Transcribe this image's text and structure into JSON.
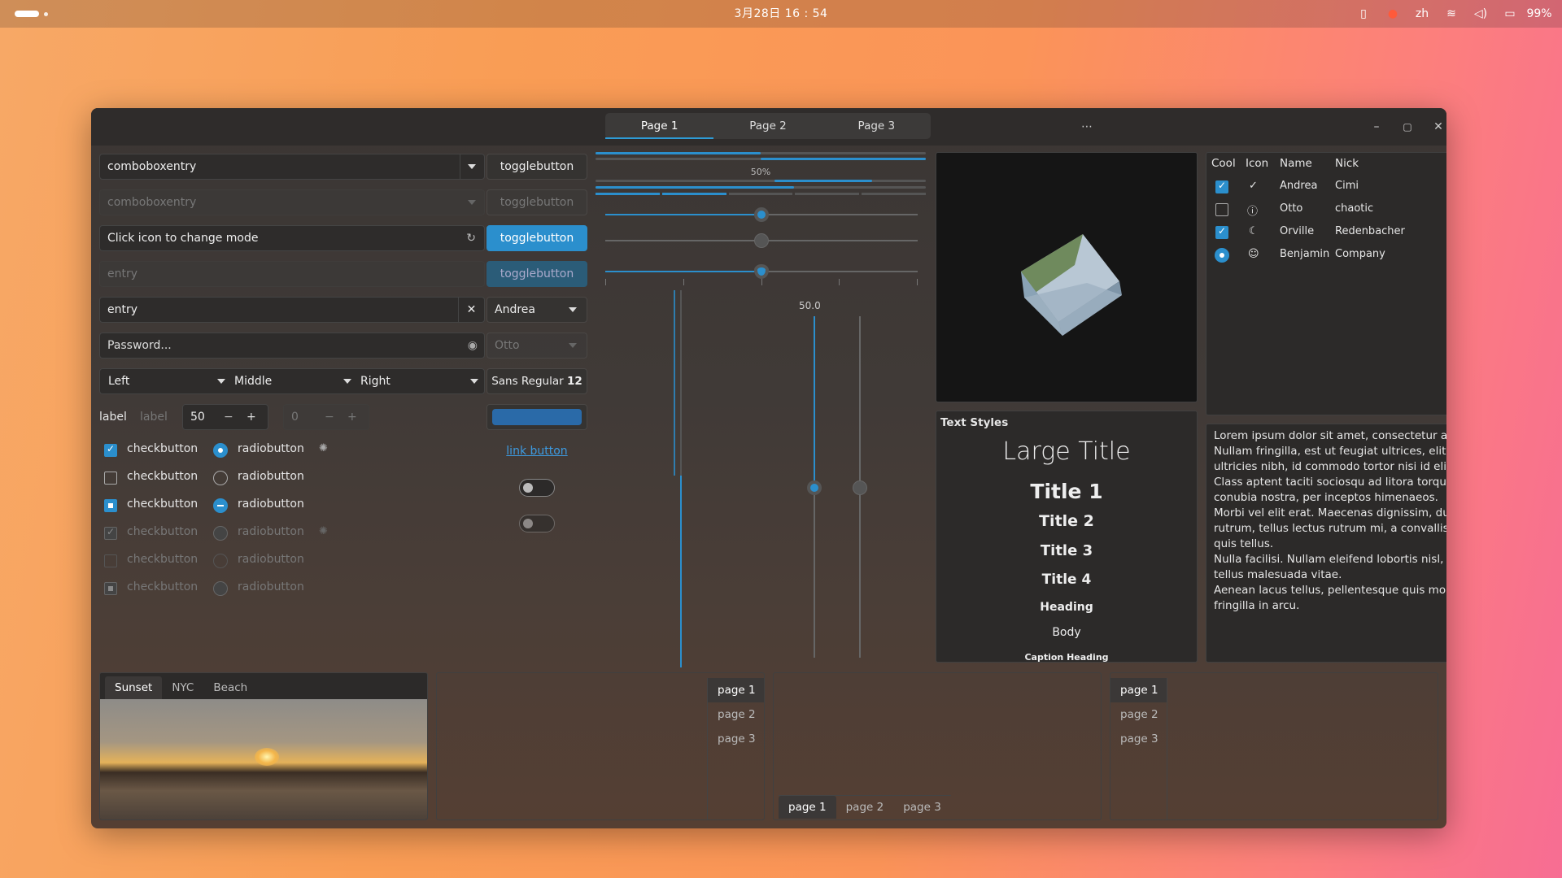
{
  "topbar": {
    "datetime": "3月28日 16 : 54",
    "lang": "zh",
    "battery": "99%"
  },
  "window": {
    "stack_switcher": [
      "Page 1",
      "Page 2",
      "Page 3"
    ],
    "controls": {
      "more": "⋯",
      "minimize": "–",
      "maximize": "▢",
      "close": "✕"
    }
  },
  "left": {
    "combo1": "comboboxentry",
    "combo2": "comboboxentry",
    "mode_entry": "Click icon to change mode",
    "entry_placeholder": "entry",
    "entry_value": "entry",
    "password_placeholder": "Password...",
    "combos": [
      "Left",
      "Middle",
      "Right"
    ],
    "label1": "label",
    "label2": "label",
    "spin1": "50",
    "spin2": "0",
    "checkbutton": "checkbutton",
    "radiobutton": "radiobutton"
  },
  "buttons": {
    "toggle": "togglebutton",
    "combo_a": "Andrea",
    "combo_b": "Otto",
    "font_name": "Sans Regular",
    "font_size": "12",
    "link": "link button"
  },
  "progress": {
    "label": "50%",
    "level": 0.5
  },
  "scale_value": "50.0",
  "text_styles": {
    "heading": "Text Styles",
    "large_title": "Large Title",
    "title1": "Title 1",
    "title2": "Title 2",
    "title3": "Title 3",
    "title4": "Title 4",
    "heading_s": "Heading",
    "body": "Body",
    "caption_heading": "Caption Heading"
  },
  "treeview": {
    "headers": [
      "Cool",
      "Icon",
      "Name",
      "Nick"
    ],
    "rows": [
      {
        "name": "Andrea",
        "nick": "Cimi",
        "icon": "check-icon"
      },
      {
        "name": "Otto",
        "nick": "chaotic",
        "icon": "warning-icon"
      },
      {
        "name": "Orville",
        "nick": "Redenbacher",
        "icon": "moon-icon"
      },
      {
        "name": "Benjamin",
        "nick": "Company",
        "icon": "face-icon"
      }
    ]
  },
  "lorem": [
    "Lorem ipsum dolor sit amet, consectetur adipiscing elit.",
    "Nullam fringilla, est ut feugiat ultrices, elit lacus ultricies nibh, id commodo tortor nisi id elit.",
    "Class aptent taciti sociosqu ad litora torquent per conubia nostra, per inceptos himenaeos.",
    "Morbi vel elit erat. Maecenas dignissim, dui et pharetra rutrum, tellus lectus rutrum mi, a convallis libero nisi quis tellus.",
    "Nulla facilisi. Nullam eleifend lobortis nisl, in porttitor tellus malesuada vitae.",
    "Aenean lacus tellus, pellentesque quis molestie quis, fringilla in arcu."
  ],
  "image_tabs": [
    "Sunset",
    "NYC",
    "Beach"
  ],
  "notebook_pages": [
    "page 1",
    "page 2",
    "page 3"
  ],
  "colors": {
    "accent": "#2b8fcd"
  }
}
